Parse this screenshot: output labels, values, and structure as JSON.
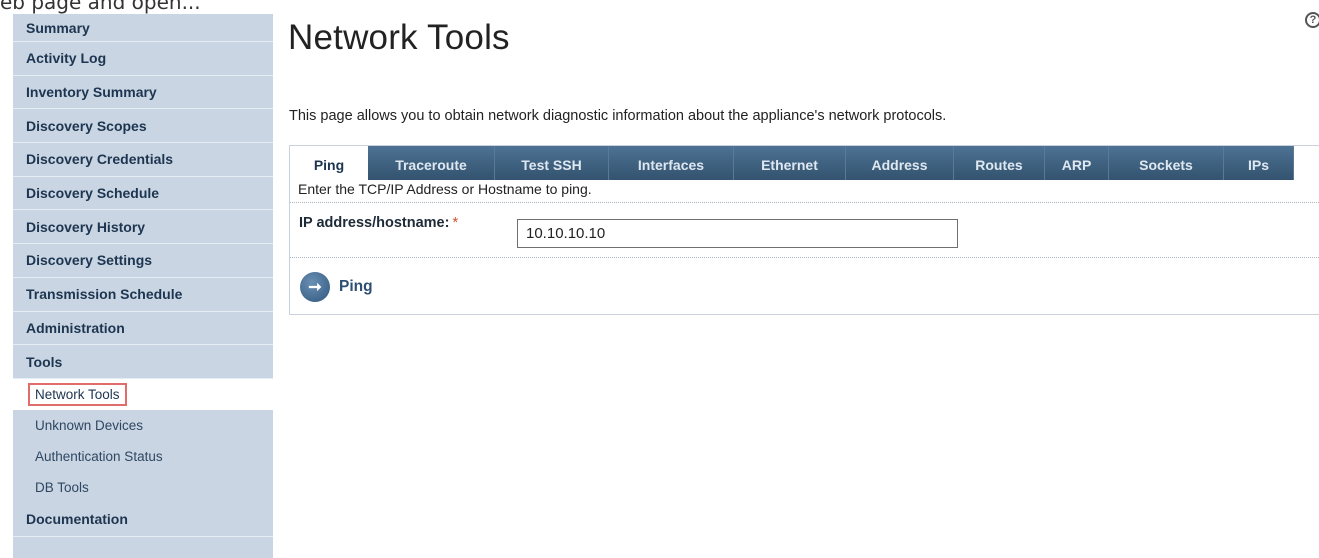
{
  "top_caption": "eb page and open...",
  "sidebar": {
    "items": [
      {
        "label": "Summary"
      },
      {
        "label": "Activity Log"
      },
      {
        "label": "Inventory Summary"
      },
      {
        "label": "Discovery Scopes"
      },
      {
        "label": "Discovery Credentials"
      },
      {
        "label": "Discovery Schedule"
      },
      {
        "label": "Discovery History"
      },
      {
        "label": "Discovery Settings"
      },
      {
        "label": "Transmission Schedule"
      },
      {
        "label": "Administration"
      },
      {
        "label": "Tools"
      }
    ],
    "tools_subitems": [
      {
        "label": "Network Tools"
      },
      {
        "label": "Unknown Devices"
      },
      {
        "label": "Authentication Status"
      },
      {
        "label": "DB Tools"
      }
    ],
    "bottom_item": {
      "label": "Documentation"
    }
  },
  "page": {
    "title": "Network Tools",
    "help_symbol": "?",
    "description": "This page allows you to obtain network diagnostic information about the appliance's network protocols."
  },
  "tabs": [
    {
      "label": "Ping"
    },
    {
      "label": "Traceroute"
    },
    {
      "label": "Test SSH"
    },
    {
      "label": "Interfaces"
    },
    {
      "label": "Ethernet"
    },
    {
      "label": "Address"
    },
    {
      "label": "Routes"
    },
    {
      "label": "ARP"
    },
    {
      "label": "Sockets"
    },
    {
      "label": "IPs"
    }
  ],
  "ping_panel": {
    "instruction": "Enter the TCP/IP Address or Hostname to ping.",
    "field_label": "IP address/hostname:",
    "required_mark": "*",
    "field_value": "10.10.10.10",
    "button_label": "Ping",
    "button_icon": "arrow-right-icon"
  },
  "colors": {
    "sidebar_bg": "#c9d5e2",
    "tab_bar": "#3e5f80",
    "active_highlight_border": "#e06c6c",
    "required_mark": "#d0502e"
  }
}
